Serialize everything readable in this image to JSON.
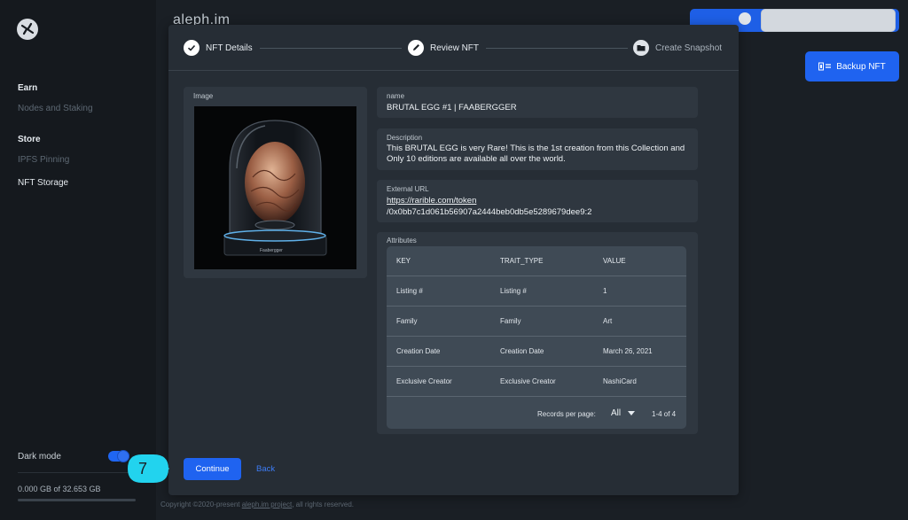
{
  "app": {
    "title": "aleph.im"
  },
  "sidebar": {
    "sections": [
      {
        "label": "Earn",
        "items": [
          {
            "label": "Nodes and Staking"
          }
        ]
      },
      {
        "label": "Store",
        "items": [
          {
            "label": "IPFS Pinning"
          },
          {
            "label": "NFT Storage"
          }
        ]
      }
    ],
    "dark_mode_label": "Dark mode",
    "dark_mode_on": true,
    "storage_text": "0.000 GB of 32.653 GB",
    "storage_used_fraction": 0.0
  },
  "header": {
    "backup_button_label": "Backup NFT"
  },
  "stepper": {
    "steps": [
      {
        "label": "NFT Details",
        "state": "completed"
      },
      {
        "label": "Review NFT",
        "state": "current"
      },
      {
        "label": "Create Snapshot",
        "state": "upcoming"
      }
    ]
  },
  "review": {
    "image_label": "Image",
    "name_label": "name",
    "name_value": "BRUTAL EGG #1 | FAABERGGER",
    "description_label": "Description",
    "description_value": "This BRUTAL EGG is very Rare! This is the 1st creation from this Collection and Only 10 editions are available all over the world.",
    "external_url_label": "External URL",
    "external_url_line1": "https://rarible.com/token",
    "external_url_line2": "/0x0bb7c1d061b56907a2444beb0db5e5289679dee9:2",
    "attributes_label": "Attributes",
    "image_caption": "Faabergger"
  },
  "attributes_table": {
    "columns": [
      "KEY",
      "TRAIT_TYPE",
      "VALUE"
    ],
    "rows": [
      [
        "Listing #",
        "Listing #",
        "1"
      ],
      [
        "Family",
        "Family",
        "Art"
      ],
      [
        "Creation Date",
        "Creation Date",
        "March 26, 2021"
      ],
      [
        "Exclusive Creator",
        "Exclusive Creator",
        "NashiCard"
      ]
    ],
    "records_per_page_label": "Records per page:",
    "records_per_page_value": "All",
    "range_text": "1-4 of 4"
  },
  "actions": {
    "continue_label": "Continue",
    "back_label": "Back"
  },
  "callout": {
    "number": "7"
  },
  "footer": {
    "prefix": "Copyright ©2020-present ",
    "link": "aleph.im project",
    "suffix": ", all rights reserved."
  },
  "colors": {
    "accent": "#1f63f0",
    "callout": "#22d3ee",
    "sidebar_bg": "#15191e",
    "modal_bg": "#262d35"
  }
}
